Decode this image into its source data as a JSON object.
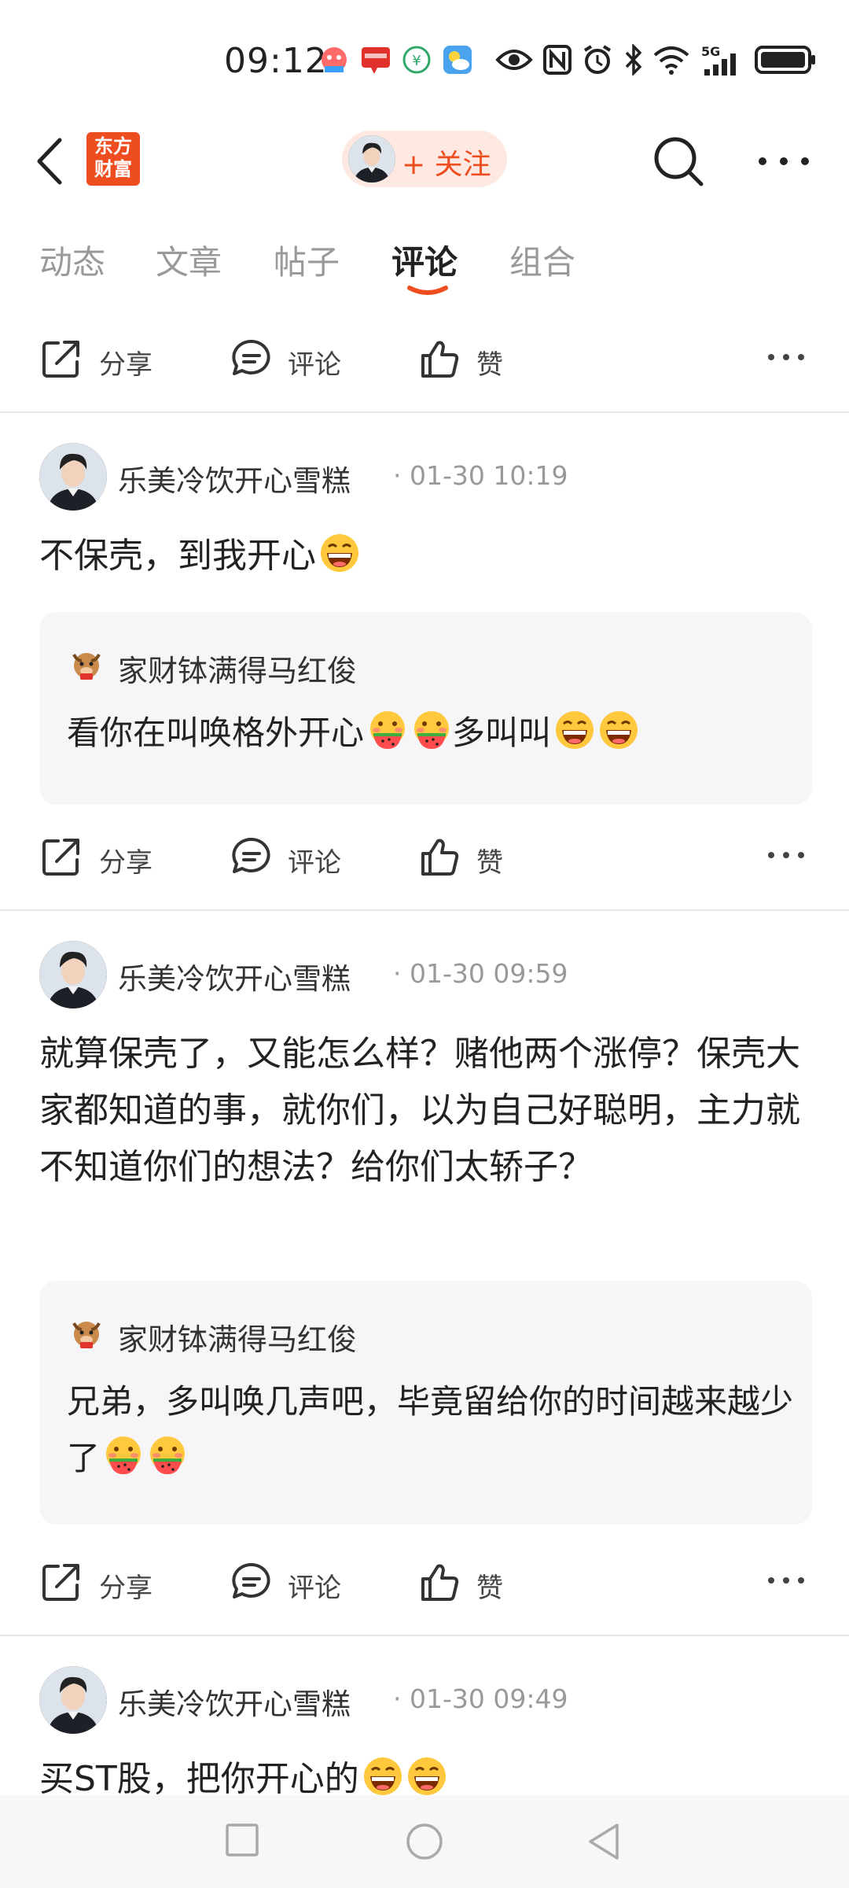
{
  "status_bar": {
    "time": "09:12",
    "icons": [
      "app-notification-icon",
      "yunshanfu-icon",
      "wechat-pay-icon",
      "weather-icon",
      "eye-icon",
      "nfc-icon",
      "alarm-icon",
      "bluetooth-icon",
      "wifi-icon",
      "5g-signal-icon",
      "battery-icon"
    ],
    "network_label": "5G"
  },
  "header": {
    "logo_text": "东方\n财富",
    "follow_label": "+ 关注",
    "accent_color": "#ee4d1f"
  },
  "tabs": [
    {
      "label": "动态",
      "active": false
    },
    {
      "label": "文章",
      "active": false
    },
    {
      "label": "帖子",
      "active": false
    },
    {
      "label": "评论",
      "active": true
    },
    {
      "label": "组合",
      "active": false
    }
  ],
  "actions": {
    "share": "分享",
    "comment": "评论",
    "like": "赞"
  },
  "comments": [
    {
      "author": "乐美冷饮开心雪糕",
      "time": "01-30 10:19",
      "text": "不保壳，到我开心",
      "text_emojis": [
        "laughing-emoji"
      ],
      "reply": {
        "author": "家财钵满得马红俊",
        "text_parts": [
          "看你在叫唤格外开心",
          "多叫叫"
        ],
        "emojis": [
          "watermelon-emoji",
          "watermelon-emoji",
          "laughing-emoji",
          "laughing-emoji"
        ]
      }
    },
    {
      "author": "乐美冷饮开心雪糕",
      "time": "01-30 09:59",
      "text": "就算保壳了，又能怎么样？赌他两个涨停？保壳大家都知道的事，就你们，以为自己好聪明，主力就不知道你们的想法？给你们太轿子？",
      "reply": {
        "author": "家财钵满得马红俊",
        "text": "兄弟，多叫唤几声吧，毕竟留给你的时间越来越少了",
        "emojis": [
          "watermelon-emoji",
          "watermelon-emoji"
        ]
      }
    },
    {
      "author": "乐美冷饮开心雪糕",
      "time": "01-30 09:49",
      "text": "买ST股，把你开心的",
      "text_emojis": [
        "laughing-emoji",
        "laughing-emoji"
      ]
    }
  ],
  "nav_bar": {
    "icons": [
      "recents-square-icon",
      "home-circle-icon",
      "back-triangle-icon"
    ]
  }
}
